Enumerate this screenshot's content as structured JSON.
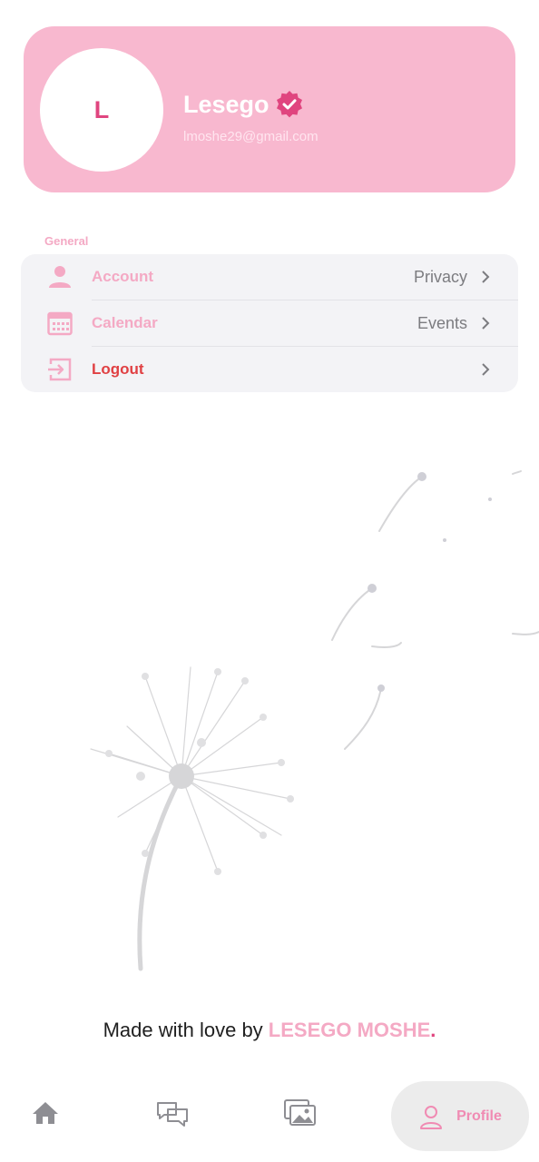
{
  "profile": {
    "initial": "L",
    "name": "Lesego",
    "email": "lmoshe29@gmail.com"
  },
  "general": {
    "title": "General",
    "items": [
      {
        "label": "Account",
        "value": "Privacy",
        "icon": "person-icon"
      },
      {
        "label": "Calendar",
        "value": "Events",
        "icon": "calendar-icon"
      },
      {
        "label": "Logout",
        "value": "",
        "icon": "logout-icon"
      }
    ]
  },
  "footer": {
    "prefix": "Made with love by ",
    "author": "LESEGO MOSHE",
    "suffix": "."
  },
  "bottom_nav": {
    "items": [
      {
        "icon": "home-icon",
        "label": ""
      },
      {
        "icon": "chat-icon",
        "label": ""
      },
      {
        "icon": "gallery-icon",
        "label": ""
      },
      {
        "icon": "profile-icon",
        "label": "Profile",
        "active": true
      }
    ]
  },
  "colors": {
    "accent": "#f8b8cf",
    "accent_text": "#f4a9c4",
    "danger": "#e04043",
    "verified": "#e0457f"
  }
}
